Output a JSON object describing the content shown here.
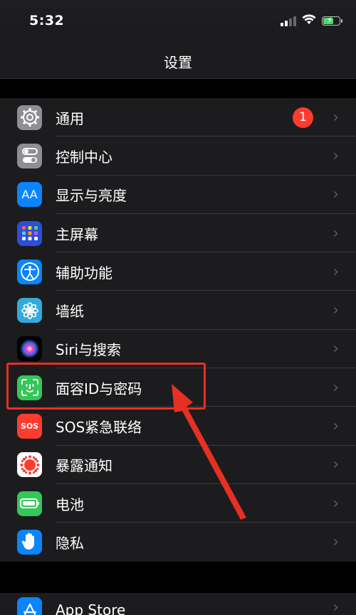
{
  "status_bar": {
    "time": "5:32",
    "icons": [
      "cellular-signal-icon",
      "wifi-icon",
      "battery-charging-icon"
    ],
    "battery_color": "#4cd964"
  },
  "nav": {
    "title": "设置"
  },
  "settings": {
    "items": [
      {
        "label": "通用",
        "icon": "gear-icon",
        "icon_bg": "#8e8e93",
        "badge": "1"
      },
      {
        "label": "控制中心",
        "icon": "toggle-switches-icon",
        "icon_bg": "#8e8e93"
      },
      {
        "label": "显示与亮度",
        "icon": "display-aa-icon",
        "icon_glyph": "AA",
        "icon_bg": "#0a84ff"
      },
      {
        "label": "主屏幕",
        "icon": "home-screen-grid-icon",
        "icon_bg": "#2c4fd8"
      },
      {
        "label": "辅助功能",
        "icon": "accessibility-icon",
        "icon_bg": "#0a84ff"
      },
      {
        "label": "墙纸",
        "icon": "wallpaper-flower-icon",
        "icon_bg": "#34aadc"
      },
      {
        "label": "Siri与搜索",
        "icon": "siri-icon",
        "icon_bg": "#1c1c1e"
      },
      {
        "label": "面容ID与密码",
        "icon": "face-id-icon",
        "icon_bg": "#34c759"
      },
      {
        "label": "SOS紧急联络",
        "icon": "sos-icon",
        "icon_glyph": "SOS",
        "icon_bg": "#ff3b30"
      },
      {
        "label": "暴露通知",
        "icon": "exposure-notification-icon",
        "icon_bg": "#ffffff"
      },
      {
        "label": "电池",
        "icon": "battery-icon",
        "icon_bg": "#34c759"
      },
      {
        "label": "隐私",
        "icon": "privacy-hand-icon",
        "icon_bg": "#0a84ff"
      }
    ],
    "group2": [
      {
        "label": "App Store",
        "icon": "app-store-icon",
        "icon_bg": "#0a84ff"
      }
    ]
  },
  "annotation": {
    "highlight_color": "#e63023"
  }
}
